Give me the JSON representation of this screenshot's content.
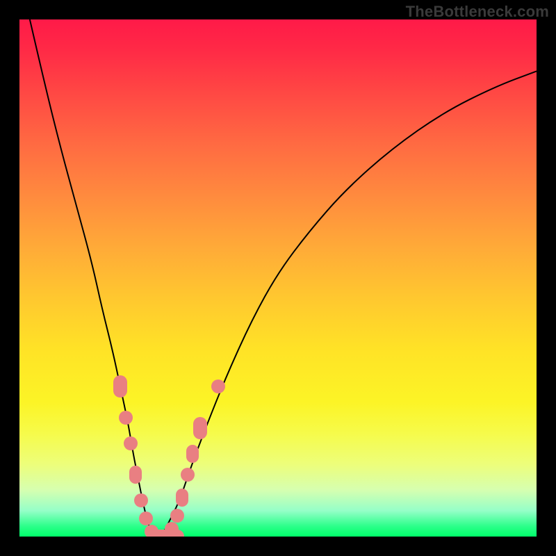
{
  "watermark": "TheBottleneck.com",
  "colors": {
    "frame": "#000000",
    "curve": "#000000",
    "marker": "#e97f82",
    "gradient_top": "#ff1a48",
    "gradient_mid": "#ffe326",
    "gradient_bottom": "#00ff6a"
  },
  "chart_data": {
    "type": "line",
    "title": "",
    "xlabel": "",
    "ylabel": "",
    "xlim": [
      0,
      100
    ],
    "ylim": [
      0,
      100
    ],
    "grid": false,
    "legend": false,
    "series": [
      {
        "name": "bottleneck-curve",
        "x": [
          2,
          5,
          8,
          11,
          14,
          16,
          18,
          19.5,
          21,
          22,
          23,
          24,
          25,
          26,
          27,
          28,
          29,
          31,
          33,
          36,
          40,
          45,
          50,
          56,
          63,
          72,
          82,
          92,
          100
        ],
        "y": [
          100,
          87,
          75,
          64,
          53,
          44,
          36,
          29,
          22,
          16,
          11,
          6,
          2,
          0,
          0,
          1,
          3,
          7,
          13,
          21,
          31,
          42,
          51,
          59,
          67,
          75,
          82,
          87,
          90
        ]
      }
    ],
    "markers": [
      {
        "x": 19.5,
        "y": 29,
        "shape": "pill"
      },
      {
        "x": 20.5,
        "y": 23,
        "shape": "dot"
      },
      {
        "x": 21.5,
        "y": 18,
        "shape": "dot"
      },
      {
        "x": 22.5,
        "y": 12,
        "shape": "smallpill"
      },
      {
        "x": 23.5,
        "y": 7,
        "shape": "dot"
      },
      {
        "x": 24.5,
        "y": 3.5,
        "shape": "dot"
      },
      {
        "x": 25.5,
        "y": 1,
        "shape": "dot"
      },
      {
        "x": 26.0,
        "y": 0,
        "shape": "wide"
      },
      {
        "x": 29.5,
        "y": 1.5,
        "shape": "dot"
      },
      {
        "x": 30.5,
        "y": 4,
        "shape": "dot"
      },
      {
        "x": 31.5,
        "y": 7.5,
        "shape": "smallpill"
      },
      {
        "x": 32.5,
        "y": 12,
        "shape": "dot"
      },
      {
        "x": 33.5,
        "y": 16,
        "shape": "smallpill"
      },
      {
        "x": 35.0,
        "y": 21,
        "shape": "pill"
      },
      {
        "x": 38.5,
        "y": 29,
        "shape": "dot"
      }
    ],
    "annotations": [
      {
        "text": "TheBottleneck.com",
        "position": "top-right"
      }
    ]
  }
}
